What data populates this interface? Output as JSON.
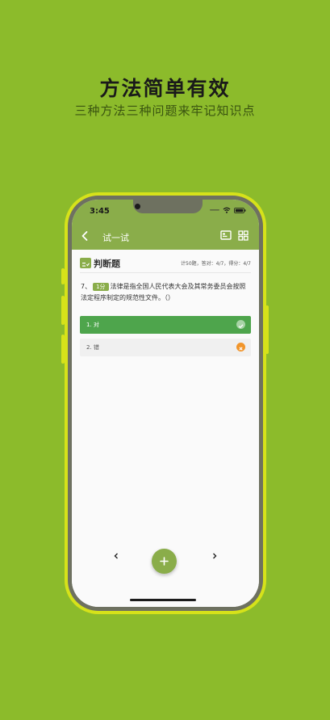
{
  "promo": {
    "headline": "方法简单有效",
    "subheadline": "三种方法三种问题来牢记知识点"
  },
  "status_bar": {
    "time": "3:45"
  },
  "app_bar": {
    "title": "试一试",
    "back_icon": "chevron-left-icon",
    "icon_a": "answer-card-icon",
    "icon_b": "grid-icon"
  },
  "question": {
    "type_label": "判断题",
    "stats": "计50题，答对：4/7，得分：4/7",
    "number": "7、",
    "score_badge": "1分",
    "text": "法律是指全国人民代表大会及其常务委员会按照法定程序制定的规范性文件。（）",
    "options": [
      {
        "label": "1. 对",
        "state": "correct",
        "mark_icon": "check-icon"
      },
      {
        "label": "2. 错",
        "state": "wrong",
        "mark_icon": "close-icon"
      }
    ]
  },
  "nav": {
    "prev_icon": "chevron-left-icon",
    "next_icon": "chevron-right-icon",
    "add_icon": "plus-icon"
  },
  "colors": {
    "background": "#8cbb2b",
    "app_bar": "#8aad4a",
    "correct": "#4ea54c",
    "wrong": "#f1952b",
    "phone_frame": "#d6e21a"
  }
}
